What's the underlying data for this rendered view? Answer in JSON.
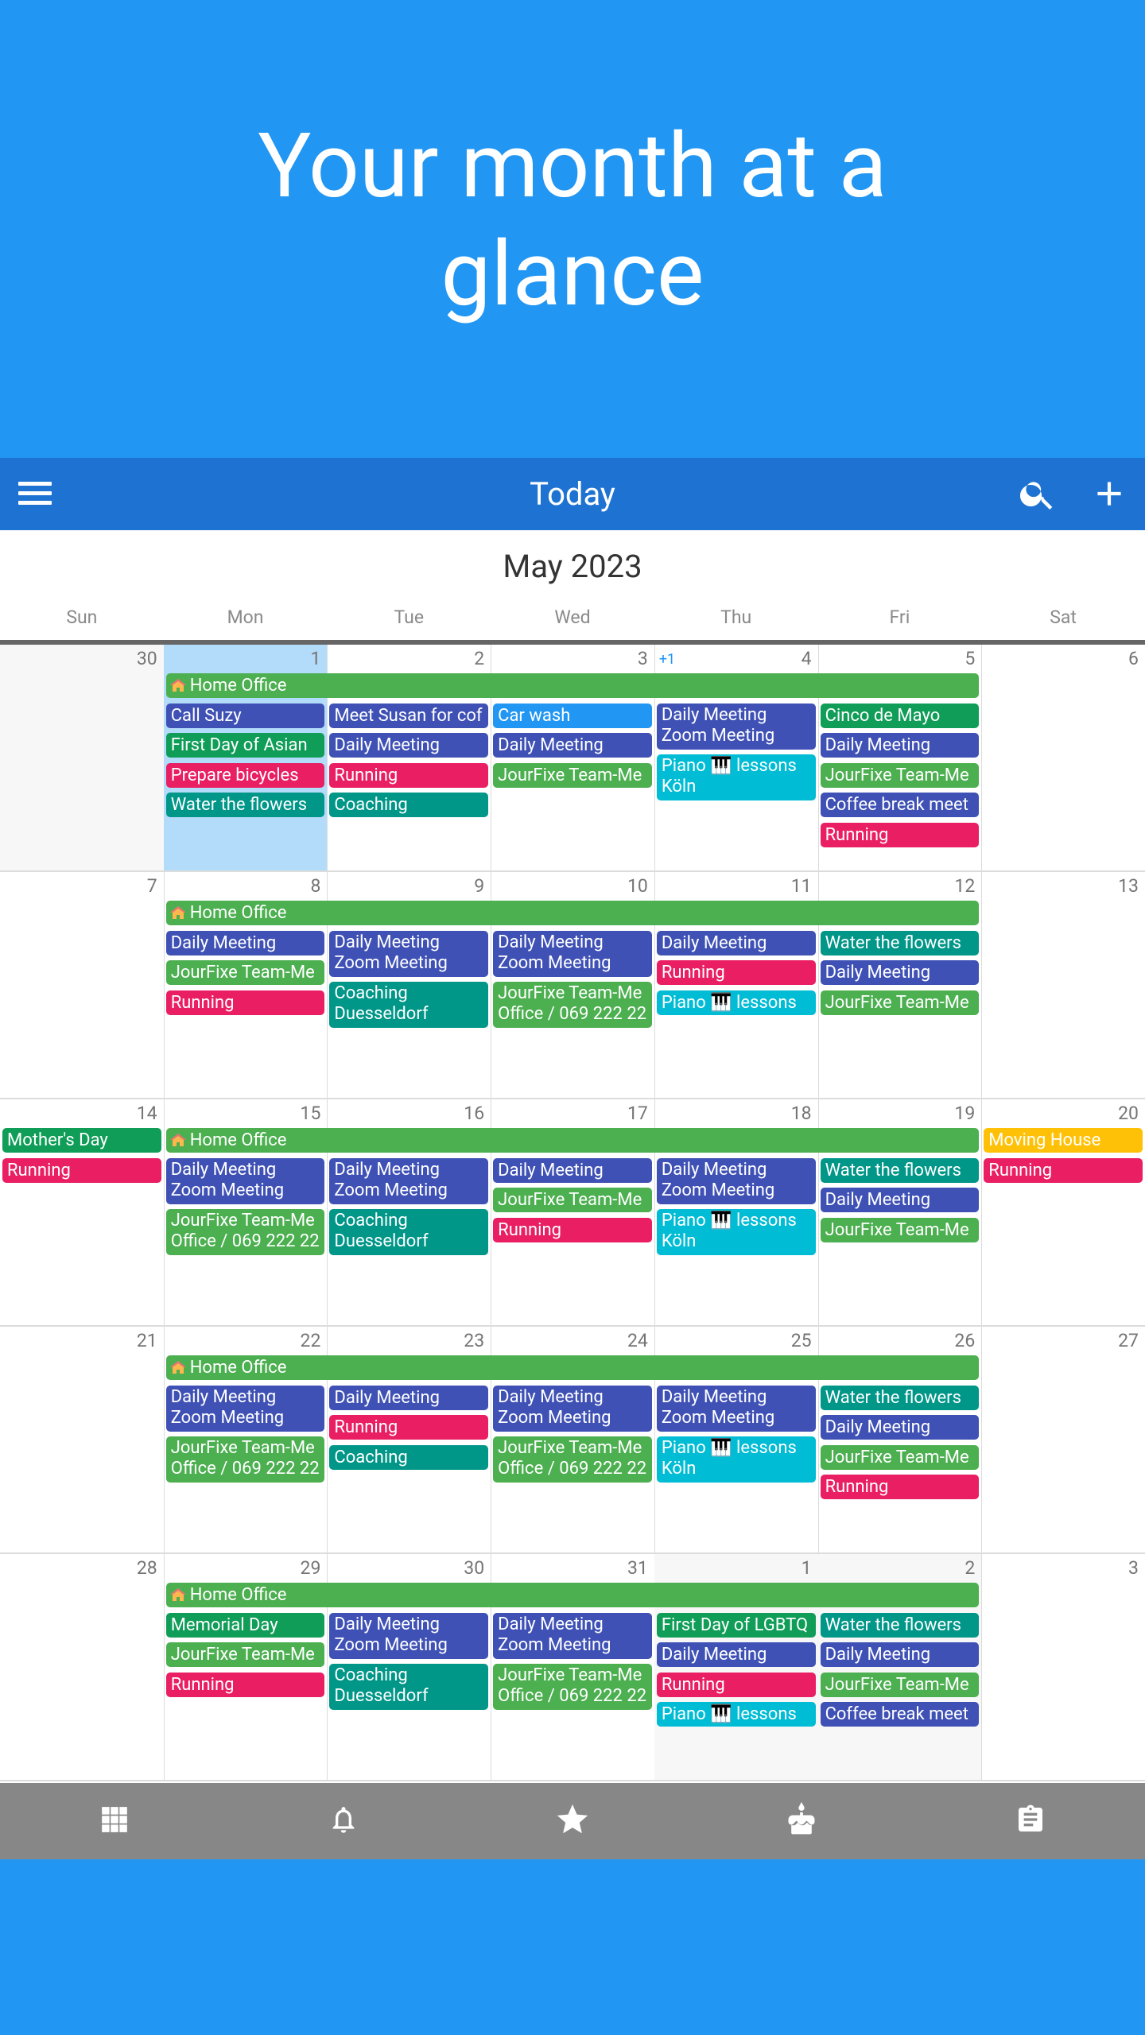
{
  "hero": {
    "title": "Your month at a glance"
  },
  "appbar": {
    "title": "Today"
  },
  "calendar": {
    "month": "May 2023",
    "weekdays": [
      "Sun",
      "Mon",
      "Tue",
      "Wed",
      "Thu",
      "Fri",
      "Sat"
    ],
    "weeks": [
      {
        "days": [
          {
            "num": "30",
            "state": "other"
          },
          {
            "num": "1",
            "state": "today"
          },
          {
            "num": "2"
          },
          {
            "num": "3"
          },
          {
            "num": "4",
            "more": "+1"
          },
          {
            "num": "5"
          },
          {
            "num": "6"
          }
        ],
        "spans": [
          {
            "label": "Home Office",
            "start": 1,
            "end": 5,
            "color": "green",
            "icon": "house-icon"
          }
        ],
        "events": [
          [],
          [
            {
              "t": [
                "Call Suzy"
              ],
              "c": "indigo"
            },
            {
              "t": [
                "First Day of Asian"
              ],
              "c": "teal2"
            },
            {
              "t": [
                "Prepare bicycles"
              ],
              "c": "pink"
            },
            {
              "t": [
                "Water the flowers"
              ],
              "c": "teal"
            }
          ],
          [
            {
              "t": [
                "Meet Susan for cof"
              ],
              "c": "indigo"
            },
            {
              "t": [
                "Daily Meeting"
              ],
              "c": "indigo"
            },
            {
              "t": [
                "Running"
              ],
              "c": "pink"
            },
            {
              "t": [
                "Coaching"
              ],
              "c": "teal"
            }
          ],
          [
            {
              "t": [
                "Car wash"
              ],
              "c": "blue"
            },
            {
              "t": [
                "Daily Meeting"
              ],
              "c": "indigo"
            },
            {
              "t": [
                "JourFixe Team-Me"
              ],
              "c": "green"
            }
          ],
          [
            {
              "t": [
                "Daily Meeting",
                "Zoom Meeting"
              ],
              "c": "indigo"
            },
            {
              "t": [
                "Piano 🎹 lessons",
                "Köln"
              ],
              "c": "cyan"
            }
          ],
          [
            {
              "t": [
                "Cinco de Mayo"
              ],
              "c": "teal2"
            },
            {
              "t": [
                "Daily Meeting"
              ],
              "c": "indigo"
            },
            {
              "t": [
                "JourFixe Team-Me"
              ],
              "c": "green"
            },
            {
              "t": [
                "Coffee break meet"
              ],
              "c": "indigo"
            },
            {
              "t": [
                "Running"
              ],
              "c": "pink"
            }
          ],
          []
        ]
      },
      {
        "days": [
          {
            "num": "7"
          },
          {
            "num": "8"
          },
          {
            "num": "9"
          },
          {
            "num": "10"
          },
          {
            "num": "11"
          },
          {
            "num": "12"
          },
          {
            "num": "13"
          }
        ],
        "spans": [
          {
            "label": "Home Office",
            "start": 1,
            "end": 5,
            "color": "green",
            "icon": "house-icon"
          }
        ],
        "events": [
          [],
          [
            {
              "t": [
                "Daily Meeting"
              ],
              "c": "indigo"
            },
            {
              "t": [
                "JourFixe Team-Me"
              ],
              "c": "green"
            },
            {
              "t": [
                "Running"
              ],
              "c": "pink"
            }
          ],
          [
            {
              "t": [
                "Daily Meeting",
                "Zoom Meeting"
              ],
              "c": "indigo"
            },
            {
              "t": [
                "Coaching",
                "Duesseldorf"
              ],
              "c": "teal"
            }
          ],
          [
            {
              "t": [
                "Daily Meeting",
                "Zoom Meeting"
              ],
              "c": "indigo"
            },
            {
              "t": [
                "JourFixe Team-Me",
                "Office / 069 222 22"
              ],
              "c": "green"
            }
          ],
          [
            {
              "t": [
                "Daily Meeting"
              ],
              "c": "indigo"
            },
            {
              "t": [
                "Running"
              ],
              "c": "pink"
            },
            {
              "t": [
                "Piano 🎹 lessons"
              ],
              "c": "cyan"
            }
          ],
          [
            {
              "t": [
                "Water the flowers"
              ],
              "c": "teal"
            },
            {
              "t": [
                "Daily Meeting"
              ],
              "c": "indigo"
            },
            {
              "t": [
                "JourFixe Team-Me"
              ],
              "c": "green"
            }
          ],
          []
        ]
      },
      {
        "days": [
          {
            "num": "14"
          },
          {
            "num": "15"
          },
          {
            "num": "16"
          },
          {
            "num": "17"
          },
          {
            "num": "18"
          },
          {
            "num": "19"
          },
          {
            "num": "20"
          }
        ],
        "spans": [
          {
            "label": "Home Office",
            "start": 1,
            "end": 5,
            "color": "green",
            "icon": "house-icon"
          }
        ],
        "events": [
          [
            {
              "t": [
                "Mother's Day"
              ],
              "c": "teal2",
              "row": 0
            },
            {
              "t": [
                "Running"
              ],
              "c": "pink"
            }
          ],
          [
            {
              "t": [
                "Daily Meeting",
                "Zoom Meeting"
              ],
              "c": "indigo"
            },
            {
              "t": [
                "JourFixe Team-Me",
                "Office / 069 222 22"
              ],
              "c": "green"
            }
          ],
          [
            {
              "t": [
                "Daily Meeting",
                "Zoom Meeting"
              ],
              "c": "indigo"
            },
            {
              "t": [
                "Coaching",
                "Duesseldorf"
              ],
              "c": "teal"
            }
          ],
          [
            {
              "t": [
                "Daily Meeting"
              ],
              "c": "indigo"
            },
            {
              "t": [
                "JourFixe Team-Me"
              ],
              "c": "green"
            },
            {
              "t": [
                "Running"
              ],
              "c": "pink"
            }
          ],
          [
            {
              "t": [
                "Daily Meeting",
                "Zoom Meeting"
              ],
              "c": "indigo"
            },
            {
              "t": [
                "Piano 🎹 lessons",
                "Köln"
              ],
              "c": "cyan"
            }
          ],
          [
            {
              "t": [
                "Water the flowers"
              ],
              "c": "teal"
            },
            {
              "t": [
                "Daily Meeting"
              ],
              "c": "indigo"
            },
            {
              "t": [
                "JourFixe Team-Me"
              ],
              "c": "green"
            }
          ],
          [
            {
              "t": [
                "Moving House"
              ],
              "c": "amber",
              "row": 0
            },
            {
              "t": [
                "Running"
              ],
              "c": "pink"
            }
          ]
        ]
      },
      {
        "days": [
          {
            "num": "21"
          },
          {
            "num": "22"
          },
          {
            "num": "23"
          },
          {
            "num": "24"
          },
          {
            "num": "25"
          },
          {
            "num": "26"
          },
          {
            "num": "27"
          }
        ],
        "spans": [
          {
            "label": "Home Office",
            "start": 1,
            "end": 5,
            "color": "green",
            "icon": "house-icon"
          }
        ],
        "events": [
          [],
          [
            {
              "t": [
                "Daily Meeting",
                "Zoom Meeting"
              ],
              "c": "indigo"
            },
            {
              "t": [
                "JourFixe Team-Me",
                "Office / 069 222 22"
              ],
              "c": "green"
            }
          ],
          [
            {
              "t": [
                "Daily Meeting"
              ],
              "c": "indigo"
            },
            {
              "t": [
                "Running"
              ],
              "c": "pink"
            },
            {
              "t": [
                "Coaching"
              ],
              "c": "teal"
            }
          ],
          [
            {
              "t": [
                "Daily Meeting",
                "Zoom Meeting"
              ],
              "c": "indigo"
            },
            {
              "t": [
                "JourFixe Team-Me",
                "Office / 069 222 22"
              ],
              "c": "green"
            }
          ],
          [
            {
              "t": [
                "Daily Meeting",
                "Zoom Meeting"
              ],
              "c": "indigo"
            },
            {
              "t": [
                "Piano 🎹 lessons",
                "Köln"
              ],
              "c": "cyan"
            }
          ],
          [
            {
              "t": [
                "Water the flowers"
              ],
              "c": "teal"
            },
            {
              "t": [
                "Daily Meeting"
              ],
              "c": "indigo"
            },
            {
              "t": [
                "JourFixe Team-Me"
              ],
              "c": "green"
            },
            {
              "t": [
                "Running"
              ],
              "c": "pink"
            }
          ],
          []
        ]
      },
      {
        "days": [
          {
            "num": "28"
          },
          {
            "num": "29"
          },
          {
            "num": "30"
          },
          {
            "num": "31"
          },
          {
            "num": "1",
            "state": "other"
          },
          {
            "num": "2",
            "state": "other"
          },
          {
            "num": "3"
          }
        ],
        "spans": [
          {
            "label": "Home Office",
            "start": 1,
            "end": 5,
            "color": "green",
            "icon": "house-icon"
          }
        ],
        "events": [
          [],
          [
            {
              "t": [
                "Memorial Day"
              ],
              "c": "teal2"
            },
            {
              "t": [
                "JourFixe Team-Me"
              ],
              "c": "green"
            },
            {
              "t": [
                "Running"
              ],
              "c": "pink"
            }
          ],
          [
            {
              "t": [
                "Daily Meeting",
                "Zoom Meeting"
              ],
              "c": "indigo"
            },
            {
              "t": [
                "Coaching",
                "Duesseldorf"
              ],
              "c": "teal"
            }
          ],
          [
            {
              "t": [
                "Daily Meeting",
                "Zoom Meeting"
              ],
              "c": "indigo"
            },
            {
              "t": [
                "JourFixe Team-Me",
                "Office / 069 222 22"
              ],
              "c": "green"
            }
          ],
          [
            {
              "t": [
                "First Day of LGBTQ"
              ],
              "c": "teal2"
            },
            {
              "t": [
                "Daily Meeting"
              ],
              "c": "indigo"
            },
            {
              "t": [
                "Running"
              ],
              "c": "pink"
            },
            {
              "t": [
                "Piano 🎹 lessons"
              ],
              "c": "cyan"
            }
          ],
          [
            {
              "t": [
                "Water the flowers"
              ],
              "c": "teal"
            },
            {
              "t": [
                "Daily Meeting"
              ],
              "c": "indigo"
            },
            {
              "t": [
                "JourFixe Team-Me"
              ],
              "c": "green"
            },
            {
              "t": [
                "Coffee break meet"
              ],
              "c": "indigo"
            }
          ],
          []
        ]
      }
    ]
  },
  "colors": {
    "indigo": "#3f51b5",
    "green": "#4caf50",
    "teal": "#009688",
    "teal2": "#0f9d58",
    "pink": "#e91e63",
    "blue": "#2196f3",
    "cyan": "#00bcd4",
    "amber": "#ffc107",
    "hero_bg": "#2196f3",
    "appbar_bg": "#1e73d2",
    "bottombar_bg": "#878787",
    "today_bg": "#b3dbfa"
  },
  "bottom_nav": [
    {
      "name": "calendar-grid-icon"
    },
    {
      "name": "bell-icon"
    },
    {
      "name": "star-icon"
    },
    {
      "name": "birthday-cake-icon"
    },
    {
      "name": "clipboard-icon"
    }
  ]
}
